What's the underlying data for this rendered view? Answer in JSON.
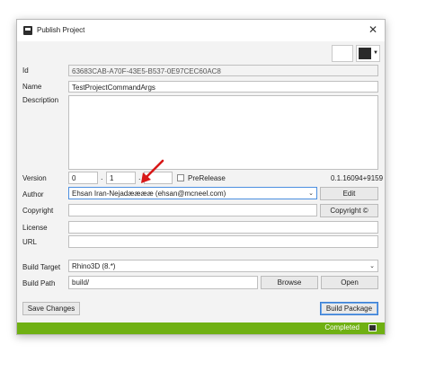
{
  "window": {
    "title": "Publish Project"
  },
  "colors": {
    "swatch1": "#ffffff",
    "swatch2": "#2b2b2b",
    "status": "#6fb013"
  },
  "fields": {
    "id_label": "Id",
    "id_value": "63683CAB-A70F-43E5-B537-0E97CEC60AC8",
    "name_label": "Name",
    "name_value": "TestProjectCommandArgs",
    "description_label": "Description",
    "description_value": "",
    "version_label": "Version",
    "version_major": "0",
    "version_minor": "1",
    "version_patch": "",
    "prerelease_label": "PreRelease",
    "version_display": "0.1.16094+9159",
    "author_label": "Author",
    "author_value": "Ehsan Iran-Nejadææææ (ehsan@mcneel.com)",
    "edit_label": "Edit",
    "copyright_label": "Copyright",
    "copyright_value": "",
    "copyright_button": "Copyright ©",
    "license_label": "License",
    "license_value": "",
    "url_label": "URL",
    "url_value": "",
    "build_target_label": "Build Target",
    "build_target_value": "Rhino3D (8.*)",
    "build_path_label": "Build Path",
    "build_path_value": "build/",
    "browse_label": "Browse",
    "open_label": "Open"
  },
  "actions": {
    "save_label": "Save Changes",
    "build_label": "Build Package"
  },
  "status": {
    "text": "Completed"
  }
}
